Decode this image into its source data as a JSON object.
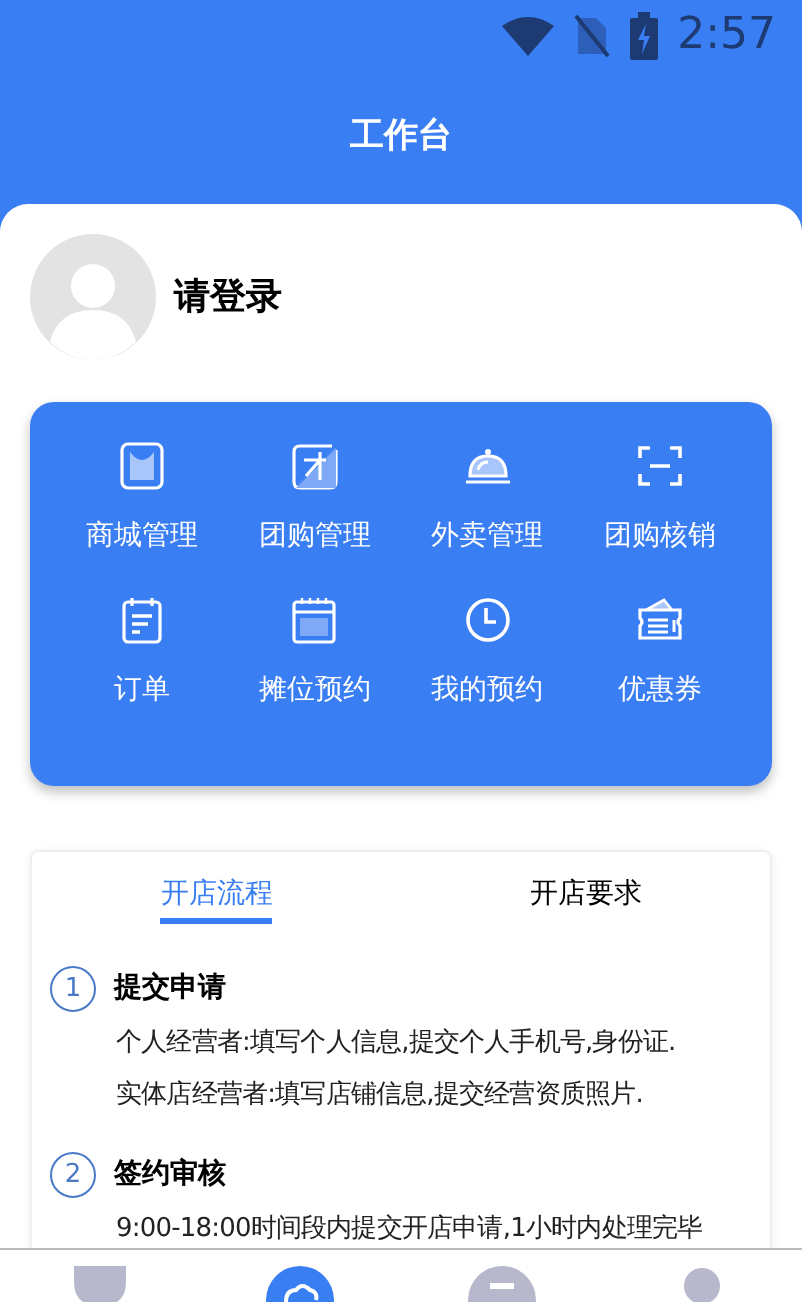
{
  "status_bar": {
    "time": "2:57"
  },
  "title": "工作台",
  "profile": {
    "login_prompt": "请登录"
  },
  "shortcuts": [
    {
      "label": "商城管理"
    },
    {
      "label": "团购管理"
    },
    {
      "label": "外卖管理"
    },
    {
      "label": "团购核销"
    },
    {
      "label": "订单"
    },
    {
      "label": "摊位预约"
    },
    {
      "label": "我的预约"
    },
    {
      "label": "优惠券"
    }
  ],
  "tabs": [
    {
      "label": "开店流程",
      "selected": true
    },
    {
      "label": "开店要求",
      "selected": false
    }
  ],
  "steps": [
    {
      "number": "1",
      "title": "提交申请",
      "lines": [
        "个人经营者:填写个人信息,提交个人手机号,身份证.",
        "实体店经营者:填写店铺信息,提交经营资质照片."
      ]
    },
    {
      "number": "2",
      "title": "签约审核",
      "lines": [
        "9:00-18:00时间段内提交开店申请,1小时内处理完毕"
      ]
    }
  ],
  "bottom_nav": [
    {
      "selected": false
    },
    {
      "selected": true
    },
    {
      "selected": false
    },
    {
      "selected": false
    }
  ]
}
